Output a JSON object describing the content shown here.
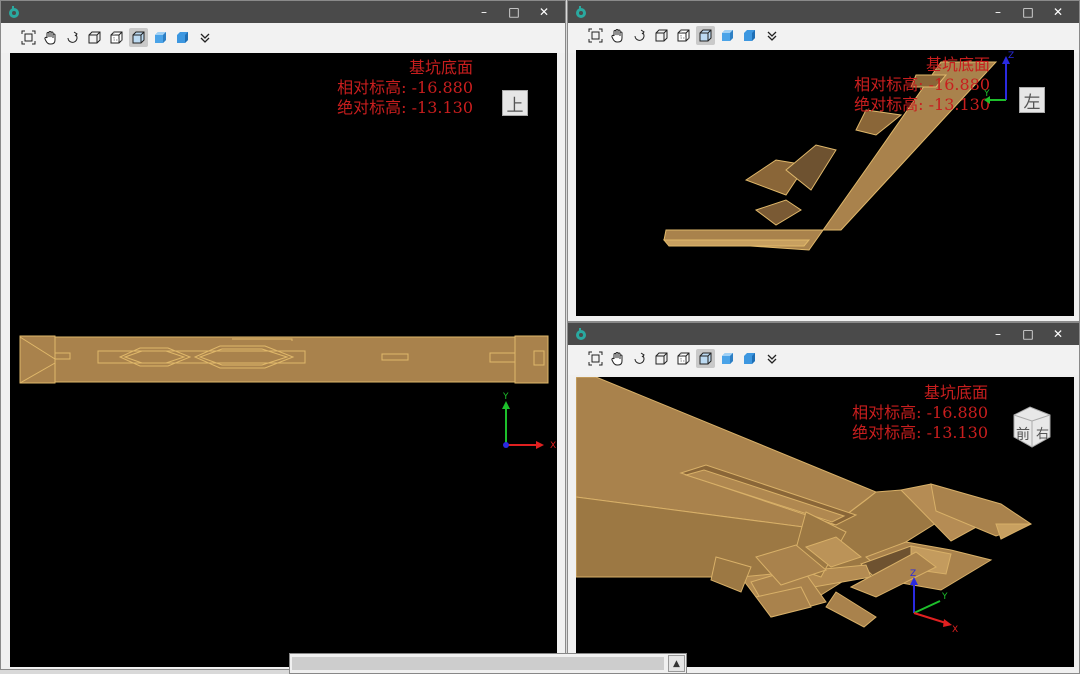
{
  "windows": [
    {
      "id": "top",
      "window_buttons": [
        "–",
        "□",
        "✕"
      ],
      "annotation": {
        "title": "基坑底面",
        "rel_elev": "相对标高: -16.880",
        "abs_elev": "绝对标高: -13.130"
      },
      "navcube_label": "上"
    },
    {
      "id": "left",
      "window_buttons": [
        "–",
        "□",
        "✕"
      ],
      "annotation": {
        "title": "基坑底面",
        "rel_elev": "相对标高: -16.880",
        "abs_elev": "绝对标高: -13.130"
      },
      "navcube_label": "左"
    },
    {
      "id": "front",
      "window_buttons": [
        "–",
        "□",
        "✕"
      ],
      "annotation": {
        "title": "基坑底面",
        "rel_elev": "相对标高: -16.880",
        "abs_elev": "绝对标高: -13.130"
      },
      "navcube_labels": [
        "前",
        "右"
      ]
    }
  ],
  "toolbar_icons": [
    "zoom-extents-icon",
    "pan-hand-icon",
    "rotate-icon",
    "wireframe-cube-icon",
    "hidden-line-cube-icon",
    "shaded-edges-cube-icon",
    "shaded-cube-icon",
    "solid-cube-icon",
    "more-chevron-icon"
  ],
  "axis_labels": {
    "x": "X",
    "y": "Y",
    "z": "Z"
  },
  "colors": {
    "model_fill": "#a9824c",
    "model_edge": "#e0b86a",
    "annotation": "#c81e1e",
    "titlebar": "#4a4a4a",
    "viewport": "#000000"
  },
  "scrollbar_arrow": "▲"
}
